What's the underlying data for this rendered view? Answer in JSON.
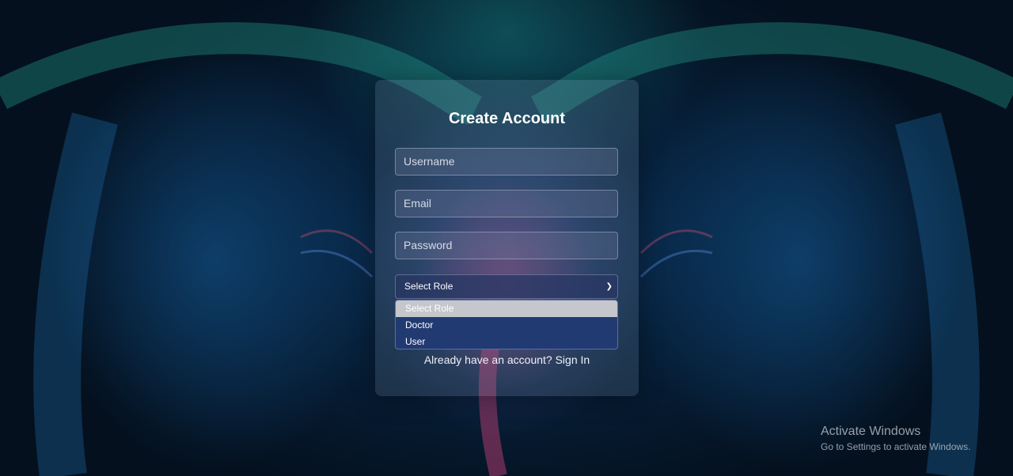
{
  "form": {
    "title": "Create Account",
    "username_placeholder": "Username",
    "email_placeholder": "Email",
    "password_placeholder": "Password",
    "role_select_value": "Select Role",
    "role_options": [
      "Select Role",
      "Doctor",
      "User"
    ],
    "signin_text": "Already have an account? Sign In"
  },
  "watermark": {
    "line1": "Activate Windows",
    "line2": "Go to Settings to activate Windows."
  },
  "colors": {
    "dropdown_bg": "#213a72",
    "selected_option_bg": "#c5c7cc",
    "title_color": "#ffffff"
  }
}
